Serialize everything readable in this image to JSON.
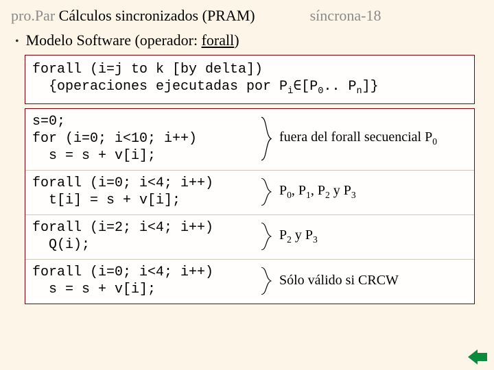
{
  "header": {
    "prefix": "pro.Par",
    "title": " Cálculos sincronizados (PRAM)",
    "right": "síncrona-18"
  },
  "bullet": {
    "text": "Modelo Software (operador: ",
    "keyword": "forall",
    "close": ")"
  },
  "syntax": {
    "line1": "forall (i=j to k [by delta])",
    "line2a": "  {operaciones ejecutadas por P",
    "line2_sub": "i",
    "line2b": "∈[P",
    "line2_sub0": "0",
    "line2c": ".. P",
    "line2_subn": "n",
    "line2d": "]}"
  },
  "blocks": [
    {
      "code": "s=0;\nfor (i=0; i<10; i++)\n  s = s + v[i];",
      "note_plain": "fuera del forall secuencial P",
      "note_subs": [
        "0"
      ],
      "note_join": ""
    },
    {
      "code": "forall (i=0; i<4; i++)\n  t[i] = s + v[i];",
      "note_plain": "P",
      "note_subs": [
        "0",
        "1",
        "2",
        "3"
      ],
      "note_join_sep": [
        ", P",
        ", P",
        " y P"
      ]
    },
    {
      "code": "forall (i=2; i<4; i++)\n  Q(i);",
      "note_plain": "P",
      "note_subs": [
        "2",
        "3"
      ],
      "note_join_sep": [
        " y P"
      ]
    },
    {
      "code": "forall (i=0; i<4; i++)\n  s = s + v[i];",
      "note_simple": "Sólo válido si CRCW"
    }
  ]
}
